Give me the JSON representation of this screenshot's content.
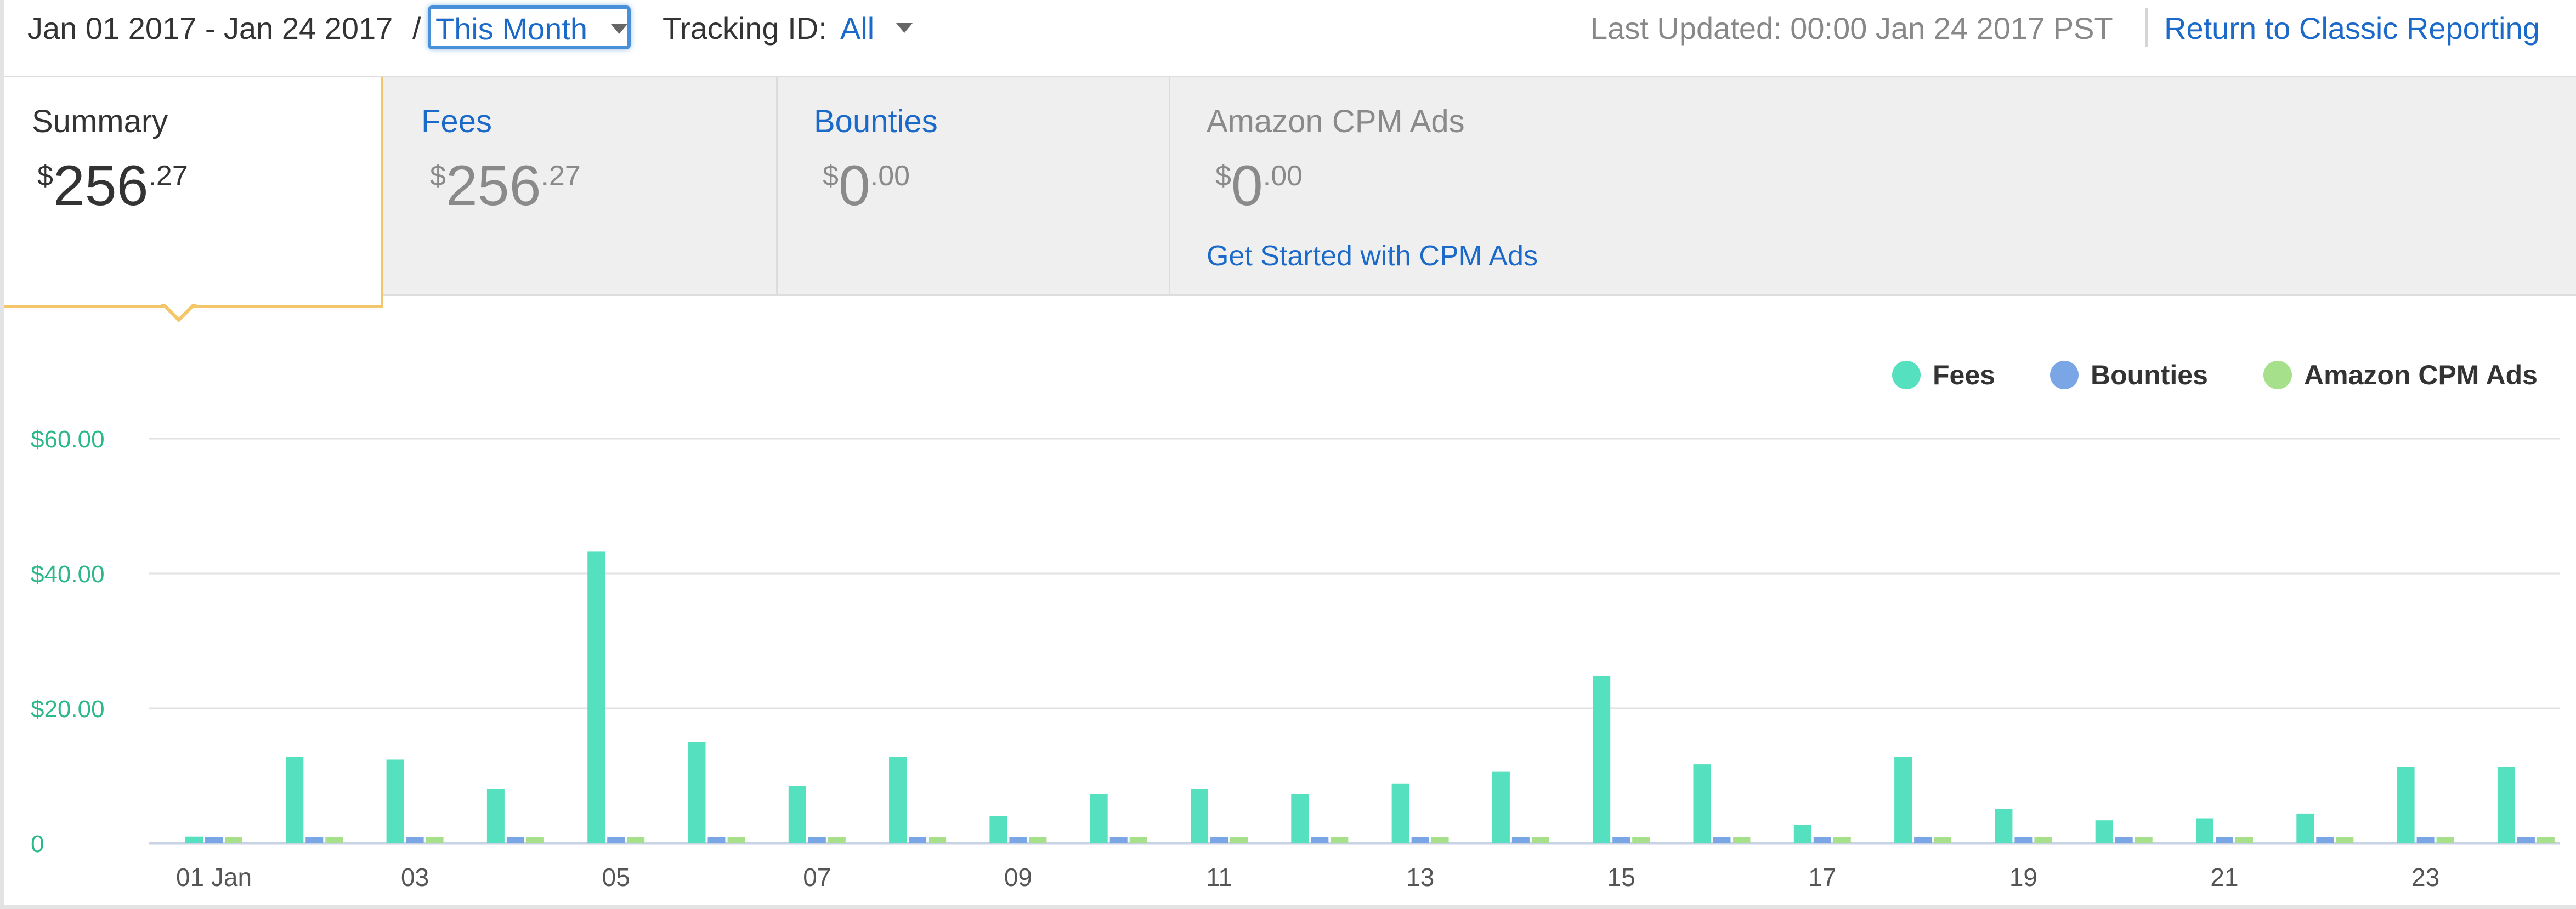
{
  "header": {
    "date_range": "Jan 01 2017 - Jan 24 2017",
    "separator": "/",
    "period_select": "This Month",
    "tracking_label": "Tracking ID:",
    "tracking_value": "All",
    "last_updated": "Last Updated: 00:00 Jan 24 2017 PST",
    "classic_link": "Return to Classic Reporting"
  },
  "tabs": [
    {
      "title": "Summary",
      "currency": "$",
      "whole": "256",
      "fraction": ".27"
    },
    {
      "title": "Fees",
      "currency": "$",
      "whole": "256",
      "fraction": ".27"
    },
    {
      "title": "Bounties",
      "currency": "$",
      "whole": "0",
      "fraction": ".00"
    },
    {
      "title": "Amazon CPM Ads",
      "currency": "$",
      "whole": "0",
      "fraction": ".00",
      "link": "Get Started with CPM Ads"
    }
  ],
  "colors": {
    "fees": "#55e0bf",
    "bounties": "#7aa6e6",
    "cpm": "#a6e08a",
    "axis_label": "#2bb88a",
    "link": "#1b6ac9",
    "accent_border": "#f3c66a"
  },
  "chart_data": {
    "type": "bar",
    "legend_position": "top-right",
    "grid": true,
    "ylim": [
      0,
      60
    ],
    "y_ticks": [
      0,
      20,
      40,
      60
    ],
    "y_tick_labels": [
      "0",
      "$20.00",
      "$40.00",
      "$60.00"
    ],
    "categories": [
      "01",
      "02",
      "03",
      "04",
      "05",
      "06",
      "07",
      "08",
      "09",
      "10",
      "11",
      "12",
      "13",
      "14",
      "15",
      "16",
      "17",
      "18",
      "19",
      "20",
      "21",
      "22",
      "23",
      "24"
    ],
    "x_tick_labels": [
      "01 Jan",
      "",
      "03",
      "",
      "05",
      "",
      "07",
      "",
      "09",
      "",
      "11",
      "",
      "13",
      "",
      "15",
      "",
      "17",
      "",
      "19",
      "",
      "21",
      "",
      "23",
      ""
    ],
    "series": [
      {
        "name": "Fees",
        "values": [
          1.0,
          12.8,
          12.4,
          8.0,
          43.3,
          15.0,
          8.5,
          12.8,
          4.0,
          7.3,
          8.0,
          7.3,
          8.8,
          10.6,
          24.8,
          11.7,
          2.7,
          12.8,
          5.1,
          3.4,
          3.7,
          4.4,
          11.3,
          11.3
        ]
      },
      {
        "name": "Bounties",
        "values": [
          0.9,
          0.9,
          0.9,
          0.9,
          0.9,
          0.9,
          0.9,
          0.9,
          0.9,
          0.9,
          0.9,
          0.9,
          0.9,
          0.9,
          0.9,
          0.9,
          0.9,
          0.9,
          0.9,
          0.9,
          0.9,
          0.9,
          0.9,
          0.9
        ]
      },
      {
        "name": "Amazon CPM Ads",
        "values": [
          0.9,
          0.9,
          0.9,
          0.9,
          0.9,
          0.9,
          0.9,
          0.9,
          0.9,
          0.9,
          0.9,
          0.9,
          0.9,
          0.9,
          0.9,
          0.9,
          0.9,
          0.9,
          0.9,
          0.9,
          0.9,
          0.9,
          0.9,
          0.9
        ]
      }
    ]
  }
}
